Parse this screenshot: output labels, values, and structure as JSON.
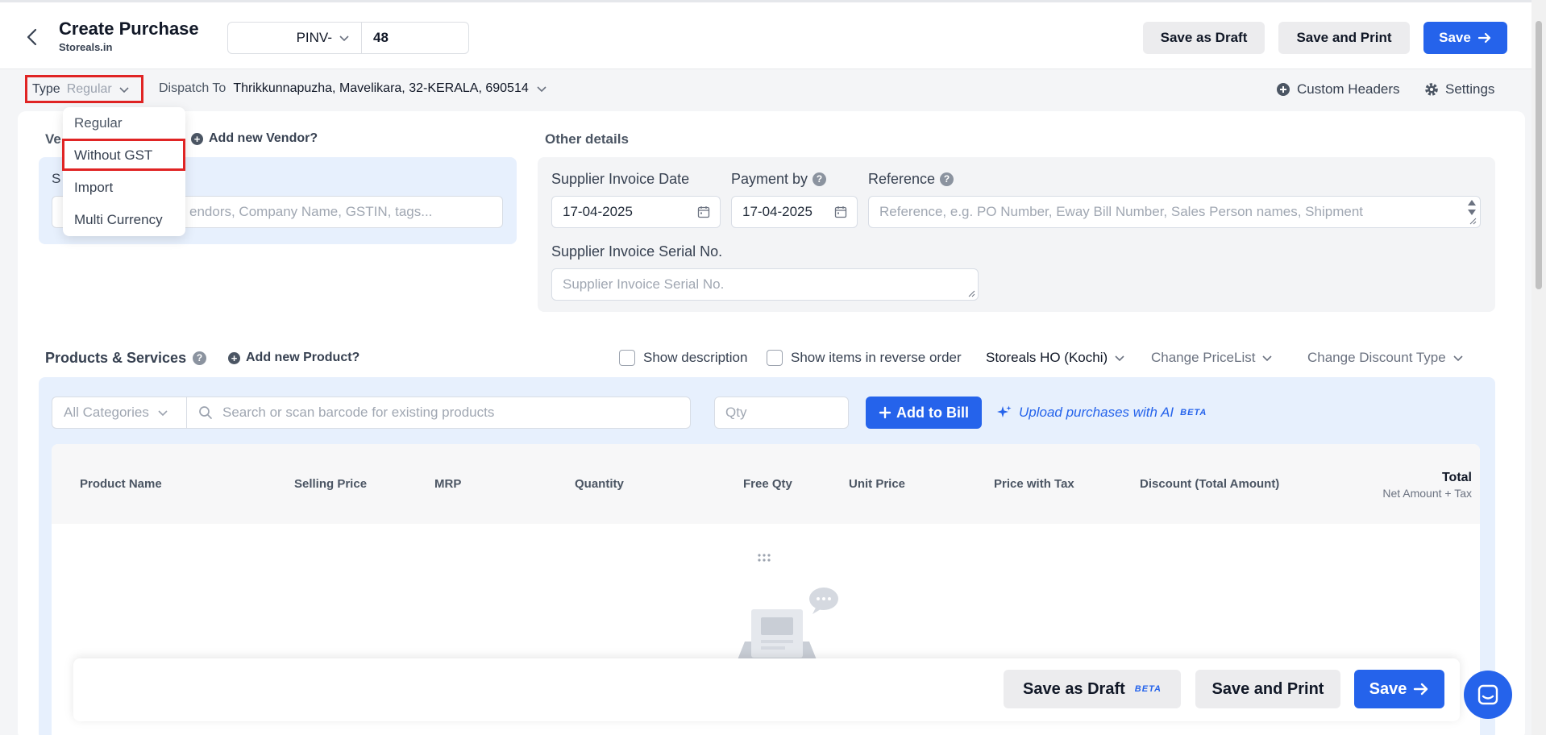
{
  "header": {
    "title": "Create Purchase",
    "subtitle": "Storeals.in",
    "invoice_prefix": "PINV-",
    "invoice_number": "48",
    "save_draft_label": "Save as Draft",
    "save_print_label": "Save and Print",
    "save_label": "Save"
  },
  "type_selector": {
    "label": "Type",
    "value": "Regular",
    "options": [
      "Regular",
      "Without GST",
      "Import",
      "Multi Currency"
    ],
    "highlighted_option": "Without GST"
  },
  "dispatch": {
    "label": "Dispatch To",
    "value": "Thrikkunnapuzha, Mavelikara, 32-KERALA, 690514"
  },
  "top_right": {
    "custom_headers_label": "Custom Headers",
    "settings_label": "Settings"
  },
  "vendor": {
    "section_label_visible": "Ve",
    "add_vendor_label": "Add new Vendor?",
    "search_label_visible": "S",
    "search_placeholder_visible": "endors, Company Name, GSTIN, tags..."
  },
  "other_details": {
    "section_label": "Other details",
    "supplier_invoice_date_label": "Supplier Invoice Date",
    "supplier_invoice_date": "17-04-2025",
    "payment_by_label": "Payment by",
    "payment_by_date": "17-04-2025",
    "reference_label": "Reference",
    "reference_placeholder": "Reference, e.g. PO Number, Eway Bill Number, Sales Person names, Shipment",
    "serial_label": "Supplier Invoice Serial No.",
    "serial_placeholder": "Supplier Invoice Serial No."
  },
  "products": {
    "title": "Products & Services",
    "add_product_label": "Add new Product?",
    "show_description_label": "Show description",
    "reverse_order_label": "Show items in reverse order",
    "warehouse_label": "Storeals HO (Kochi)",
    "change_pricelist_label": "Change PriceList",
    "change_discount_label": "Change Discount Type",
    "category_placeholder": "All Categories",
    "search_placeholder": "Search or scan barcode for existing products",
    "qty_placeholder": "Qty",
    "add_to_bill_label": "Add to Bill",
    "upload_ai_label": "Upload purchases with AI",
    "beta_label": "BETA"
  },
  "table": {
    "columns": [
      "Product Name",
      "Selling Price",
      "MRP",
      "Quantity",
      "Free Qty",
      "Unit Price",
      "Price with Tax",
      "Discount (Total Amount)"
    ],
    "total_label": "Total",
    "total_sub_label": "Net Amount + Tax"
  },
  "bottom_bar": {
    "save_draft_label": "Save as Draft",
    "beta_label": "BETA",
    "save_print_label": "Save and Print",
    "save_label": "Save"
  },
  "colors": {
    "primary": "#2563eb",
    "highlight_red": "#e02424",
    "panel_blue": "#e7f0fd"
  }
}
